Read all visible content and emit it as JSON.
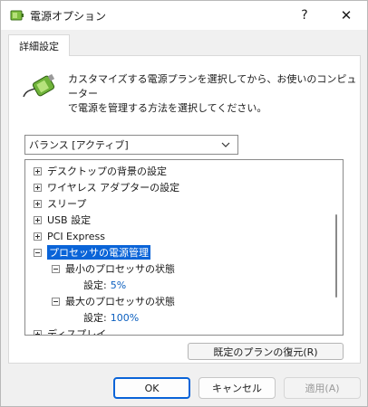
{
  "window": {
    "title": "電源オプション",
    "help_glyph": "?",
    "close_glyph": "✕",
    "icon": "power-options-icon"
  },
  "tab": {
    "label": "詳細設定"
  },
  "description": {
    "line1": "カスタマイズする電源プランを選択してから、お使いのコンピューター",
    "line2": "で電源を管理する方法を選択してください。",
    "icon": "battery-plug-icon"
  },
  "plan_select": {
    "value": "バランス [アクティブ]"
  },
  "tree": {
    "items": [
      {
        "label": "デスクトップの背景の設定",
        "expander": "plus"
      },
      {
        "label": "ワイヤレス アダプターの設定",
        "expander": "plus"
      },
      {
        "label": "スリープ",
        "expander": "plus"
      },
      {
        "label": "USB 設定",
        "expander": "plus"
      },
      {
        "label": "PCI Express",
        "expander": "plus"
      },
      {
        "label": "プロセッサの電源管理",
        "expander": "minus",
        "selected": true
      },
      {
        "label": "最小のプロセッサの状態",
        "expander": "minus"
      },
      {
        "label": "設定:",
        "value": "5%"
      },
      {
        "label": "最大のプロセッサの状態",
        "expander": "minus"
      },
      {
        "label": "設定:",
        "value": "100%"
      },
      {
        "label": "ディスプレイ",
        "expander": "plus"
      }
    ]
  },
  "buttons": {
    "restore": "既定のプランの復元(R)",
    "ok": "OK",
    "cancel": "キャンセル",
    "apply": "適用(A)"
  },
  "colors": {
    "accent": "#0a64d8",
    "value_text": "#0b5fbf"
  }
}
